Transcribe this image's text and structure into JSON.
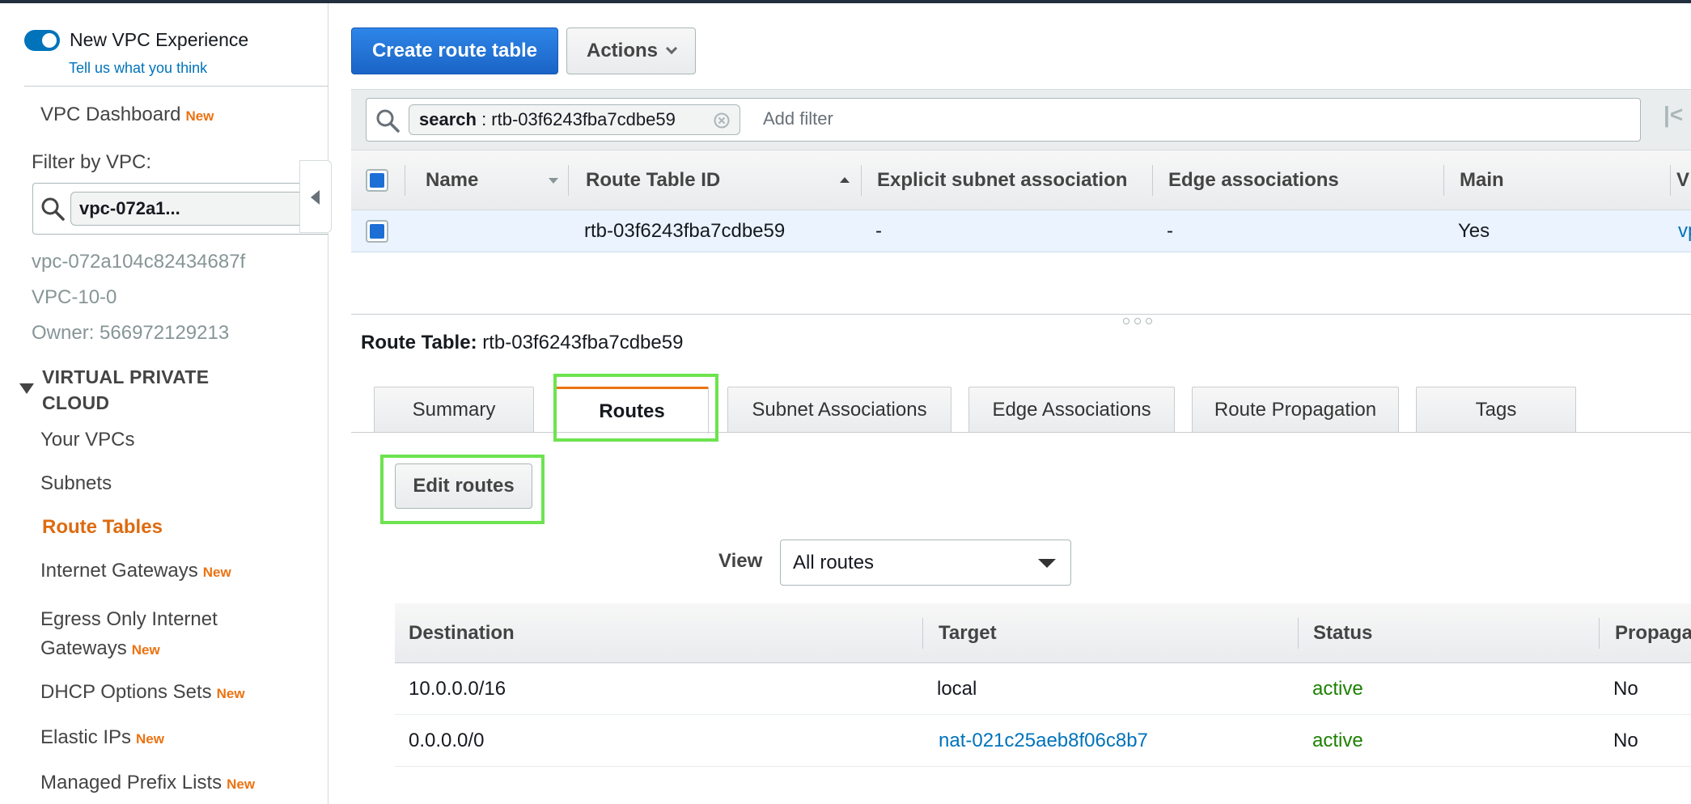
{
  "sidebar": {
    "toggle_label": "New VPC Experience",
    "feedback_link": "Tell us what you think",
    "dashboard": {
      "label": "VPC Dashboard",
      "badge": "New"
    },
    "filter_label": "Filter by VPC:",
    "filter_value": "vpc-072a1...",
    "vpc_id": "vpc-072a104c82434687f",
    "vpc_name": "VPC-10-0",
    "owner": "Owner: 566972129213",
    "section_title_line1": "VIRTUAL PRIVATE",
    "section_title_line2": "CLOUD",
    "items": [
      {
        "label": "Your VPCs",
        "badge": ""
      },
      {
        "label": "Subnets",
        "badge": ""
      },
      {
        "label": "Route Tables",
        "badge": ""
      },
      {
        "label": "Internet Gateways",
        "badge": "New"
      },
      {
        "label": "Egress Only Internet",
        "label2": "Gateways",
        "badge": "New"
      },
      {
        "label": "DHCP Options Sets",
        "badge": "New"
      },
      {
        "label": "Elastic IPs",
        "badge": "New"
      },
      {
        "label": "Managed Prefix Lists",
        "badge": "New"
      }
    ]
  },
  "toolbar": {
    "create_label": "Create route table",
    "actions_label": "Actions"
  },
  "search": {
    "chip_key": "search",
    "chip_sep": " : ",
    "chip_value": "rtb-03f6243fba7cdbe59",
    "placeholder": "Add filter",
    "first_page": "|<"
  },
  "grid": {
    "columns": [
      "Name",
      "Route Table ID",
      "Explicit subnet association",
      "Edge associations",
      "Main",
      "V"
    ],
    "row": {
      "name": "",
      "id": "rtb-03f6243fba7cdbe59",
      "explicit": "-",
      "edge": "-",
      "main": "Yes",
      "vpc": "vp"
    }
  },
  "details": {
    "title_key": "Route Table:",
    "title_value": "rtb-03f6243fba7cdbe59",
    "tabs": [
      "Summary",
      "Routes",
      "Subnet Associations",
      "Edge Associations",
      "Route Propagation",
      "Tags"
    ],
    "active_tab": "Routes",
    "edit_label": "Edit routes",
    "view_label": "View",
    "view_selected": "All routes"
  },
  "routes": {
    "columns": [
      "Destination",
      "Target",
      "Status",
      "Propaga"
    ],
    "rows": [
      {
        "destination": "10.0.0.0/16",
        "target": "local",
        "status": "active",
        "propagated": "No"
      },
      {
        "destination": "0.0.0.0/0",
        "target": "nat-021c25aeb8f06c8b7",
        "status": "active",
        "propagated": "No"
      }
    ]
  },
  "colors": {
    "primary": "#1d6fd6",
    "accent": "#ec7211",
    "active_status": "#1d8102",
    "highlight": "#6de34f",
    "link": "#0073bb"
  },
  "icons": {
    "search": "search-icon",
    "clear": "clear-icon",
    "collapse": "collapse-left-icon",
    "expand": "triangle-down-icon",
    "dropdown": "caret-down-icon"
  }
}
